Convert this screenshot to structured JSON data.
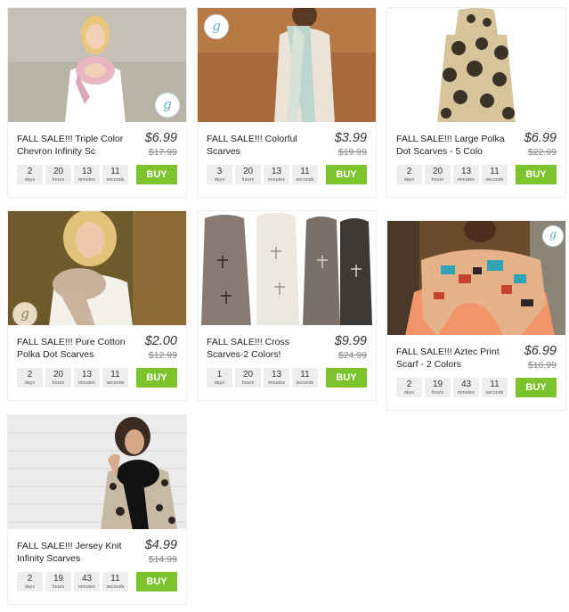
{
  "products": [
    {
      "title": "FALL SALE!!! Triple Color Chevron Infinity Sc",
      "price": "$6.99",
      "old_price": "$17.99",
      "timer": [
        "2",
        "20",
        "13",
        "11"
      ],
      "buy": "BUY",
      "img": "woman-chevron-infinity-scarf"
    },
    {
      "title": "FALL SALE!!! Colorful Scarves",
      "price": "$3.99",
      "old_price": "$19.99",
      "timer": [
        "3",
        "20",
        "13",
        "11"
      ],
      "buy": "BUY",
      "img": "woman-colorful-scarf"
    },
    {
      "title": "FALL SALE!!! Large Polka Dot Scarves - 5 Colo",
      "price": "$6.99",
      "old_price": "$22.99",
      "timer": [
        "2",
        "20",
        "13",
        "11"
      ],
      "buy": "BUY",
      "img": "polka-dot-scarf"
    },
    {
      "title": "FALL SALE!!! Pure Cotton Polka Dot Scarves",
      "price": "$2.00",
      "old_price": "$12.99",
      "timer": [
        "2",
        "20",
        "13",
        "11"
      ],
      "buy": "BUY",
      "img": "woman-cotton-scarf"
    },
    {
      "title": "FALL SALE!!! Cross Scarves-2 Colors!",
      "price": "$9.99",
      "old_price": "$24.99",
      "timer": [
        "1",
        "20",
        "13",
        "11"
      ],
      "buy": "BUY",
      "img": "cross-scarves"
    },
    {
      "title": "FALL SALE!!! Aztec Print Scarf - 2 Colors",
      "price": "$6.99",
      "old_price": "$16.99",
      "timer": [
        "2",
        "19",
        "43",
        "11"
      ],
      "buy": "BUY",
      "img": "woman-aztec-scarf"
    },
    {
      "title": "FALL SALE!!! Jersey Knit Infinity Scarves",
      "price": "$4.99",
      "old_price": "$14.99",
      "timer": [
        "2",
        "19",
        "43",
        "11"
      ],
      "buy": "BUY",
      "img": "woman-jersey-knit-scarf"
    }
  ],
  "timer_units": [
    "days",
    "hours",
    "minutes",
    "seconds"
  ],
  "logo_letter": "g",
  "colors": {
    "buy": "#7dc42c",
    "card_bg": "#eeeeee",
    "timer_bg": "#eeeeee"
  }
}
